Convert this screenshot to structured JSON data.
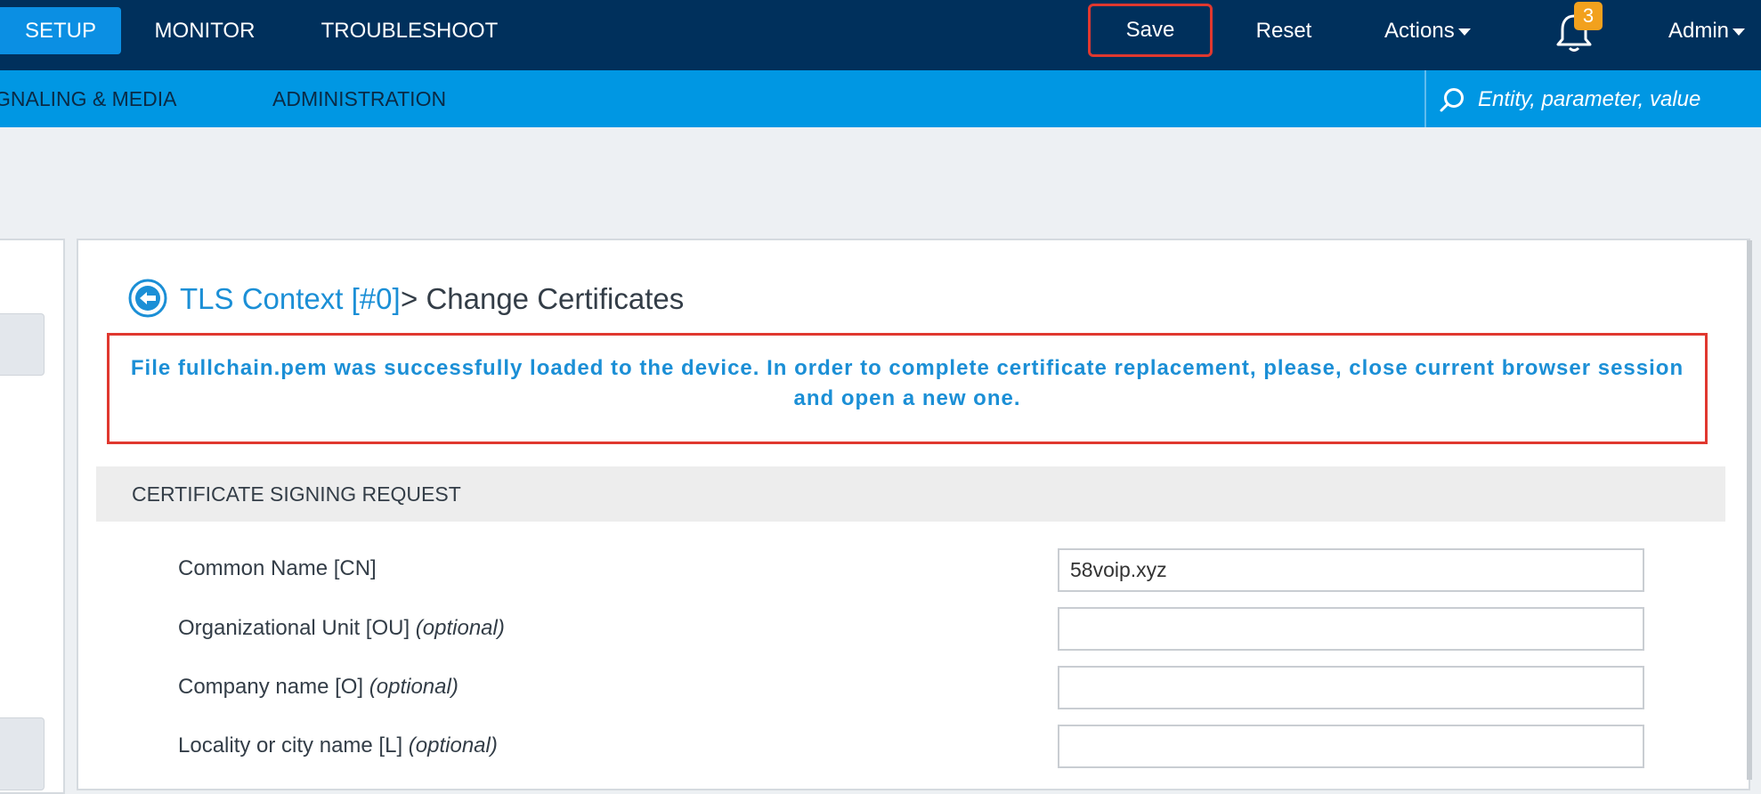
{
  "topbar": {
    "tabs": [
      {
        "label": "SETUP",
        "active": true
      },
      {
        "label": "MONITOR",
        "active": false
      },
      {
        "label": "TROUBLESHOOT",
        "active": false
      }
    ],
    "save_label": "Save",
    "reset_label": "Reset",
    "actions_label": "Actions",
    "notification_count": "3",
    "user_label": "Admin"
  },
  "subbar": {
    "items": [
      "GNALING & MEDIA",
      "ADMINISTRATION"
    ],
    "search_placeholder": "Entity, parameter, value"
  },
  "page": {
    "title_link": "TLS Context [#0]",
    "title_rest": "> Change Certificates",
    "alert_message": "File  fullchain.pem  was successfully loaded to the device. In order to complete certificate replacement, please, close current browser session and open a new one.",
    "section_title": "CERTIFICATE SIGNING REQUEST",
    "fields": [
      {
        "label": "Common Name [CN]",
        "optional": "",
        "value": "58voip.xyz"
      },
      {
        "label": "Organizational Unit [OU]",
        "optional": "(optional)",
        "value": ""
      },
      {
        "label": "Company name [O]",
        "optional": "(optional)",
        "value": ""
      },
      {
        "label": "Locality or city name [L]",
        "optional": "(optional)",
        "value": ""
      }
    ]
  },
  "colors": {
    "topbar_bg": "#00305c",
    "active_tab": "#0b8fe3",
    "subbar_bg": "#0097e3",
    "highlight_border": "#e0382f",
    "link_blue": "#1b8fd6",
    "badge": "#f2a11d"
  },
  "icons": {
    "back": "back-arrow-circle-icon",
    "bell": "bell-icon",
    "search": "search-icon",
    "dropdown": "caret-down-icon"
  }
}
